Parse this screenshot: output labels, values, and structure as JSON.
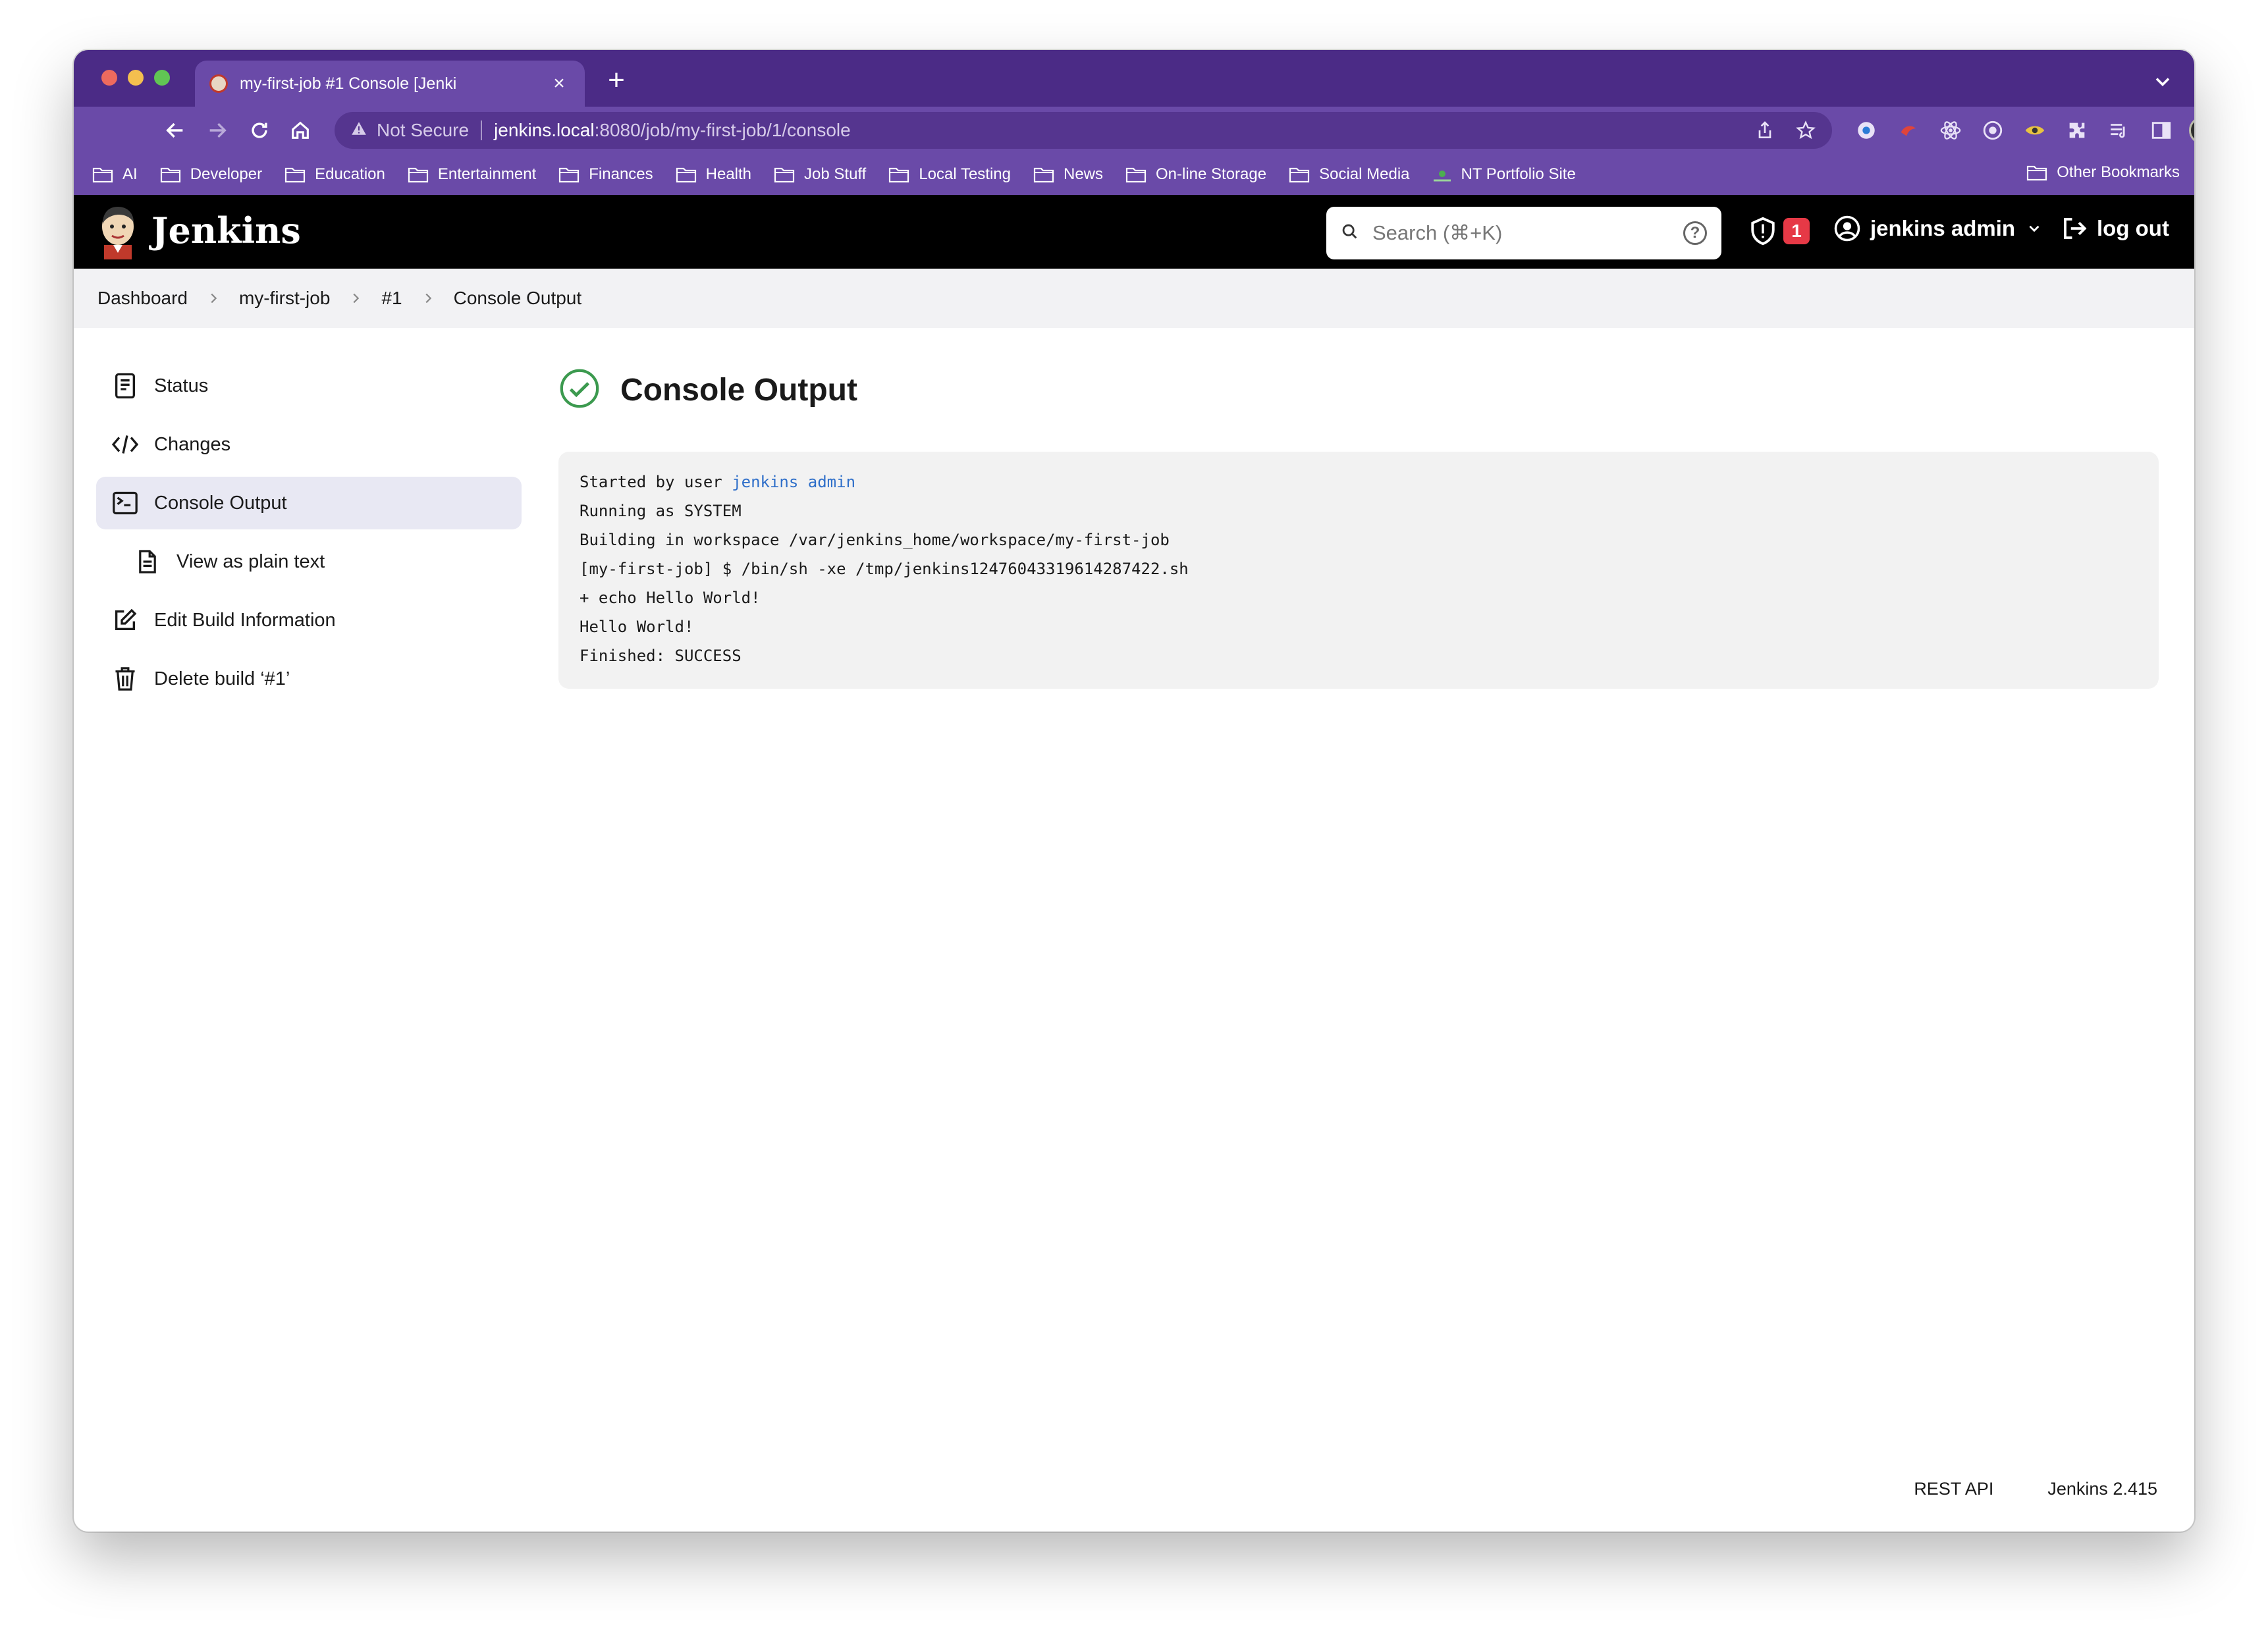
{
  "browser": {
    "tab_title": "my-first-job #1 Console [Jenki",
    "new_tab_symbol": "+",
    "close_symbol": "×",
    "security_label": "Not Secure",
    "url_host": "jenkins.local",
    "url_path": ":8080/job/my-first-job/1/console",
    "bookmarks": [
      {
        "label": "AI"
      },
      {
        "label": "Developer"
      },
      {
        "label": "Education"
      },
      {
        "label": "Entertainment"
      },
      {
        "label": "Finances"
      },
      {
        "label": "Health"
      },
      {
        "label": "Job Stuff"
      },
      {
        "label": "Local Testing"
      },
      {
        "label": "News"
      },
      {
        "label": "On-line Storage"
      },
      {
        "label": "Social Media"
      },
      {
        "label": "NT Portfolio Site"
      }
    ],
    "other_bookmarks": "Other Bookmarks"
  },
  "header": {
    "brand": "Jenkins",
    "search_placeholder": "Search (⌘+K)",
    "security_count": "1",
    "user_name": "jenkins admin",
    "logout_label": "log out"
  },
  "breadcrumb": [
    "Dashboard",
    "my-first-job",
    "#1",
    "Console Output"
  ],
  "sidebar": {
    "items": [
      {
        "label": "Status",
        "icon": "document-icon"
      },
      {
        "label": "Changes",
        "icon": "code-icon"
      },
      {
        "label": "Console Output",
        "icon": "terminal-icon"
      },
      {
        "label": "View as plain text",
        "icon": "file-text-icon"
      },
      {
        "label": "Edit Build Information",
        "icon": "edit-icon"
      },
      {
        "label": "Delete build ‘#1’",
        "icon": "trash-icon"
      }
    ]
  },
  "main": {
    "title": "Console Output",
    "status": "success",
    "console": {
      "started_prefix": "Started by user ",
      "started_user": "jenkins admin",
      "lines": [
        "Running as SYSTEM",
        "Building in workspace /var/jenkins_home/workspace/my-first-job",
        "[my-first-job] $ /bin/sh -xe /tmp/jenkins12476043319614287422.sh",
        "+ echo Hello World!",
        "Hello World!",
        "Finished: SUCCESS"
      ]
    }
  },
  "footer": {
    "rest_api": "REST API",
    "version": "Jenkins 2.415"
  },
  "colors": {
    "chrome_purple": "#4b2b86",
    "toolbar_purple": "#6a4aa8",
    "success_green": "#3c9a4f",
    "link_blue": "#2f6fc9",
    "badge_red": "#e63946"
  }
}
